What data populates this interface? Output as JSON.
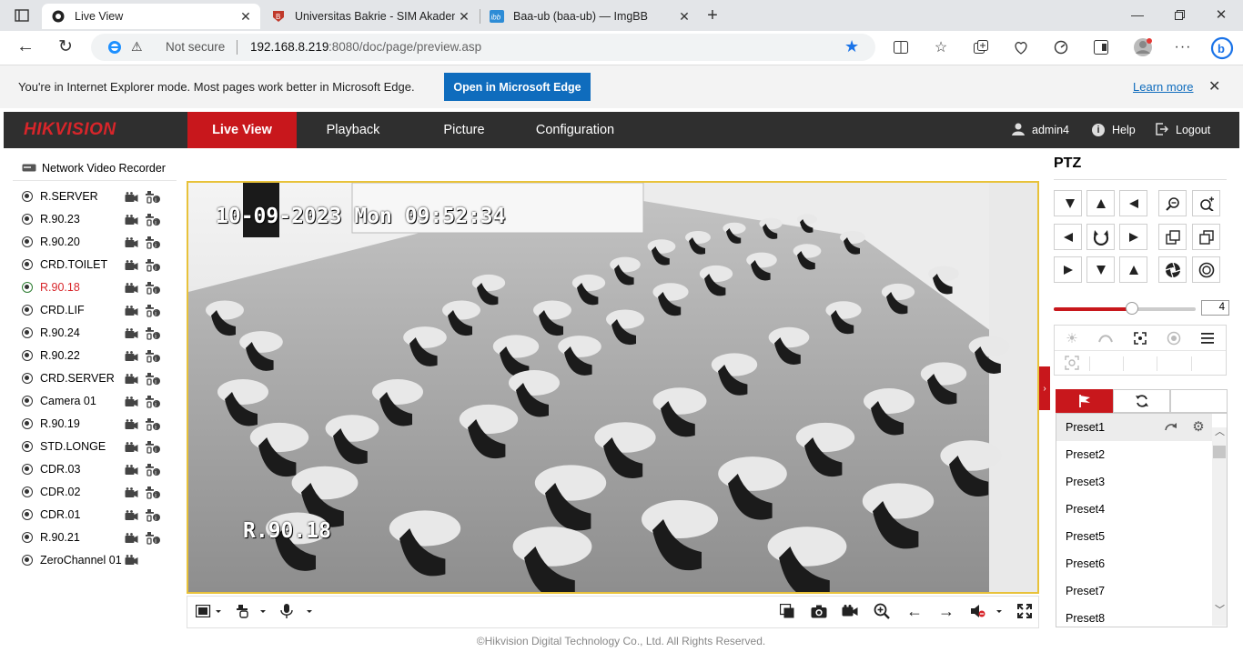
{
  "browser": {
    "tabs": [
      {
        "title": "Live View",
        "active": true,
        "icon": "camera-app-icon"
      },
      {
        "title": "Universitas Bakrie - SIM Akademi",
        "active": false,
        "icon": "shield-logo-icon"
      },
      {
        "title": "Baa-ub (baa-ub) — ImgBB",
        "active": false,
        "icon": "ibb-logo-icon"
      }
    ],
    "security_text": "Not secure",
    "url_host": "192.168.8.219",
    "url_rest": ":8080/doc/page/preview.asp",
    "ie_message": "You're in Internet Explorer mode. Most pages work better in Microsoft Edge.",
    "ie_button": "Open in Microsoft Edge",
    "ie_learn_more": "Learn more"
  },
  "app": {
    "logo": "HIKVISION",
    "nav": [
      "Live View",
      "Playback",
      "Picture",
      "Configuration"
    ],
    "user": "admin4",
    "help": "Help",
    "logout": "Logout"
  },
  "device_tree": {
    "root": "Network Video Recorder",
    "cameras": [
      "R.SERVER",
      "R.90.23",
      "R.90.20",
      "CRD.TOILET",
      "R.90.18",
      "CRD.LIF",
      "R.90.24",
      "R.90.22",
      "CRD.SERVER",
      "Camera 01",
      "R.90.19",
      "STD.LONGE",
      "CDR.03",
      "CDR.02",
      "CDR.01",
      "R.90.21",
      "ZeroChannel 01"
    ],
    "selected": "R.90.18"
  },
  "video": {
    "timestamp": "10-09-2023 Mon 09:52:34",
    "channel_label": "R.90.18",
    "border_color": "#e8c23a"
  },
  "ptz": {
    "title": "PTZ",
    "speed": "4",
    "speed_fraction": 0.55,
    "presets": [
      "Preset1",
      "Preset2",
      "Preset3",
      "Preset4",
      "Preset5",
      "Preset6",
      "Preset7",
      "Preset8"
    ]
  },
  "footer": "©Hikvision Digital Technology Co., Ltd. All Rights Reserved.",
  "colors": {
    "accent": "#c8171c",
    "header": "#2f2f2f",
    "edge_blue": "#0f6cbd"
  }
}
